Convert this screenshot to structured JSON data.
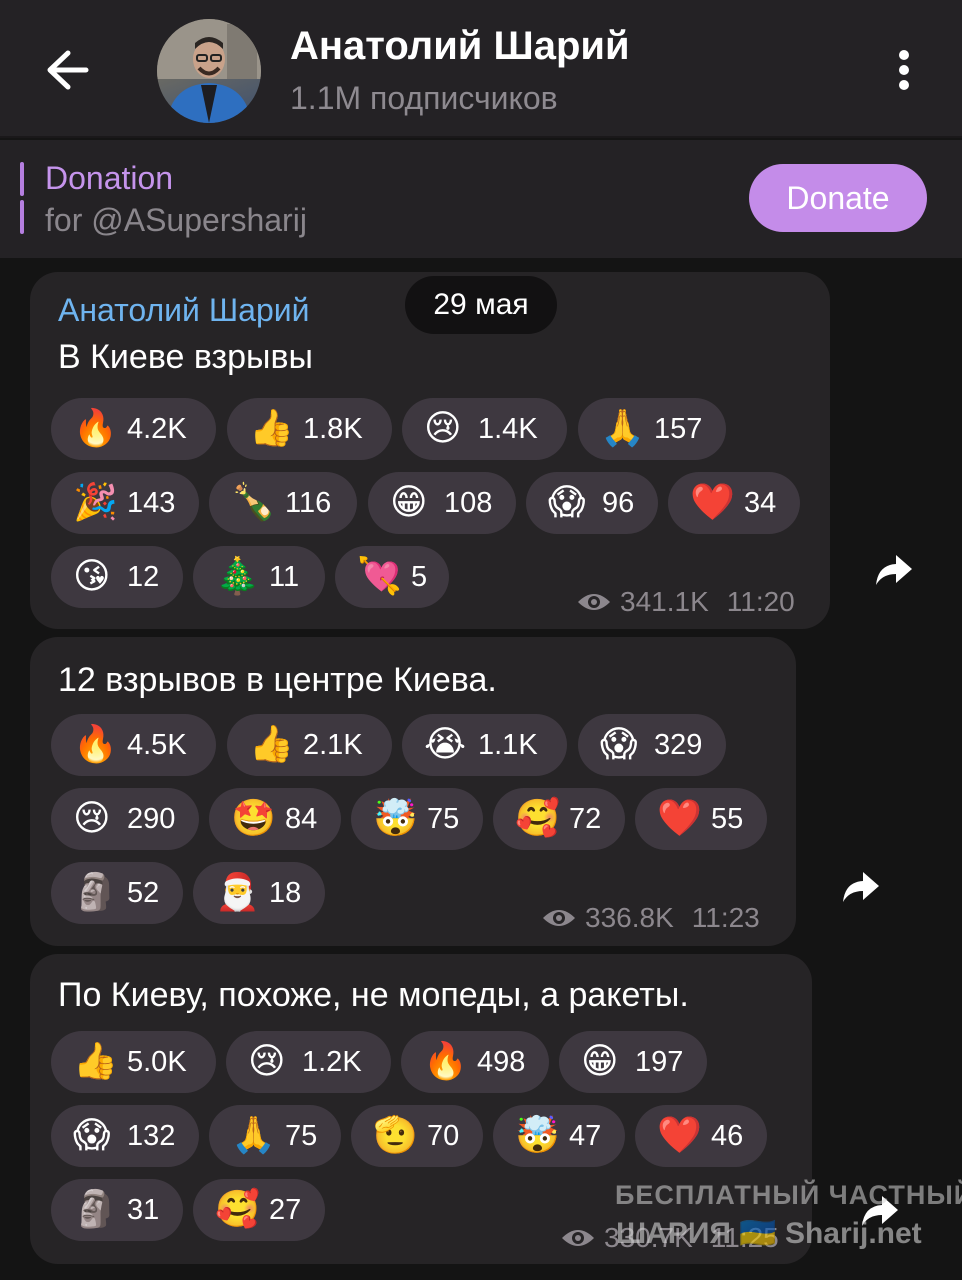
{
  "header": {
    "channel_name": "Анатолий Шарий",
    "subscribers": "1.1M подписчиков"
  },
  "pinned": {
    "title": "Donation",
    "subtitle": "for @ASupersharij",
    "button": "Donate"
  },
  "date_pill": "29 мая",
  "messages": [
    {
      "sender": "Анатолий Шарий",
      "text": "В Киеве взрывы",
      "views": "341.1K",
      "time": "11:20",
      "reactions": [
        {
          "emoji": "🔥",
          "count": "4.2K"
        },
        {
          "emoji": "👍",
          "count": "1.8K"
        },
        {
          "emoji": "😢",
          "count": "1.4K"
        },
        {
          "emoji": "🙏",
          "count": "157"
        },
        {
          "emoji": "🎉",
          "count": "143"
        },
        {
          "emoji": "🍾",
          "count": "116"
        },
        {
          "emoji": "😁",
          "count": "108"
        },
        {
          "emoji": "😱",
          "count": "96"
        },
        {
          "emoji": "❤️",
          "count": "34"
        },
        {
          "emoji": "😘",
          "count": "12"
        },
        {
          "emoji": "🎄",
          "count": "11"
        },
        {
          "emoji": "💘",
          "count": "5"
        }
      ]
    },
    {
      "text": "12 взрывов в центре Киева.",
      "views": "336.8K",
      "time": "11:23",
      "reactions": [
        {
          "emoji": "🔥",
          "count": "4.5K"
        },
        {
          "emoji": "👍",
          "count": "2.1K"
        },
        {
          "emoji": "😭",
          "count": "1.1K"
        },
        {
          "emoji": "😱",
          "count": "329"
        },
        {
          "emoji": "😢",
          "count": "290"
        },
        {
          "emoji": "🤩",
          "count": "84"
        },
        {
          "emoji": "🤯",
          "count": "75"
        },
        {
          "emoji": "🥰",
          "count": "72"
        },
        {
          "emoji": "❤️",
          "count": "55"
        },
        {
          "emoji": "🗿",
          "count": "52"
        },
        {
          "emoji": "🎅",
          "count": "18"
        }
      ]
    },
    {
      "text": "По Киеву, похоже, не мопеды, а ракеты.",
      "views": "330.7K",
      "time": "11:25",
      "reactions": [
        {
          "emoji": "👍",
          "count": "5.0K"
        },
        {
          "emoji": "😢",
          "count": "1.2K"
        },
        {
          "emoji": "🔥",
          "count": "498"
        },
        {
          "emoji": "😁",
          "count": "197"
        },
        {
          "emoji": "😱",
          "count": "132"
        },
        {
          "emoji": "🙏",
          "count": "75"
        },
        {
          "emoji": "🫡",
          "count": "70"
        },
        {
          "emoji": "🤯",
          "count": "47"
        },
        {
          "emoji": "❤️",
          "count": "46"
        },
        {
          "emoji": "🗿",
          "count": "31"
        },
        {
          "emoji": "🥰",
          "count": "27"
        }
      ]
    }
  ],
  "watermark": {
    "line1": "БЕСПЛАТНЫЙ ЧАСТНЫЙ",
    "line2": "ШАРИЯ 🇺🇦 Sharij.net"
  },
  "colors": {
    "accent": "#c48ce9",
    "sender": "#6fb4ef",
    "bubble": "#262426",
    "reaction_bg": "#3e3840"
  }
}
